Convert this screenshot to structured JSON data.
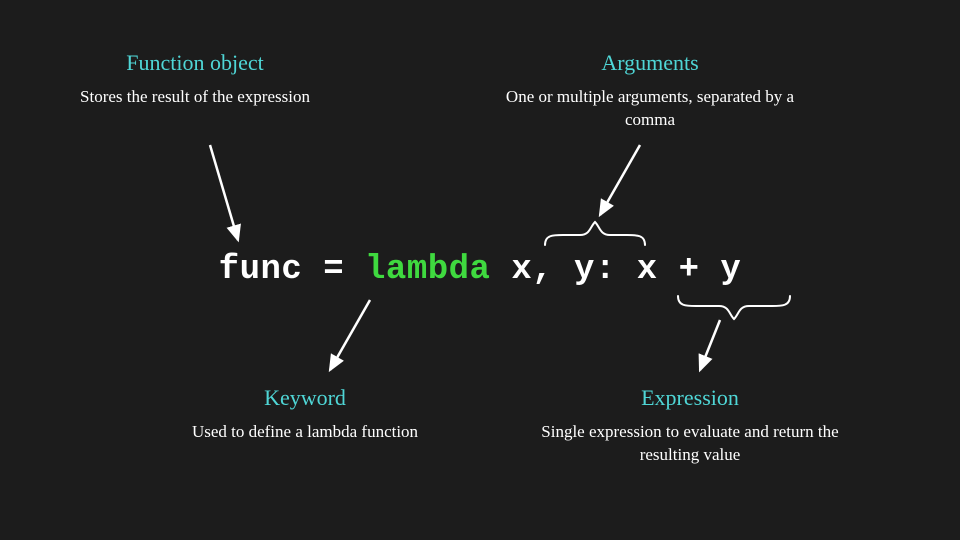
{
  "code": {
    "func_name": "func",
    "eq": " = ",
    "keyword": "lambda",
    "space": " ",
    "args": "x, y",
    "colon": ": ",
    "expression": "x + y"
  },
  "annotations": {
    "function_object": {
      "title": "Function object",
      "desc": "Stores the result of the expression"
    },
    "arguments": {
      "title": "Arguments",
      "desc": "One or multiple arguments, separated by a comma"
    },
    "keyword": {
      "title": "Keyword",
      "desc": "Used to define a lambda function"
    },
    "expression": {
      "title": "Expression",
      "desc": "Single expression to evaluate and return the resulting value"
    }
  }
}
